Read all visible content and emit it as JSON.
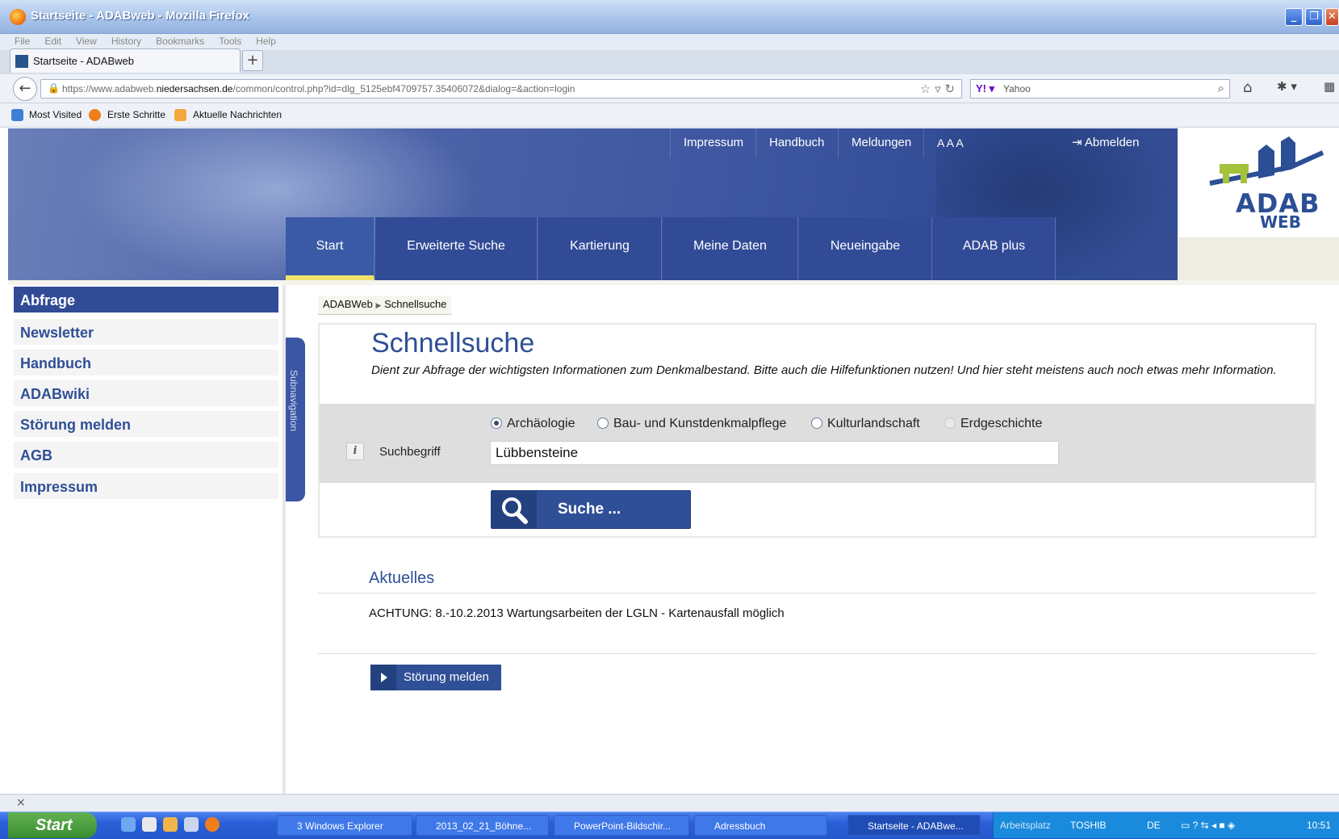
{
  "window": {
    "title": "Startseite - ADABweb - Mozilla Firefox",
    "min": "_",
    "max": "❐",
    "close": "✕"
  },
  "menubar": [
    "File",
    "Edit",
    "View",
    "History",
    "Bookmarks",
    "Tools",
    "Help"
  ],
  "tab": {
    "label": "Startseite - ADABweb",
    "new": "+"
  },
  "address": {
    "url_prefix": "https://www.adabweb.",
    "url_host": "niedersachsen.de",
    "url_rest": "/common/control.php?id=dlg_5125ebf4709757.35406072&dialog=&action=login"
  },
  "search": {
    "engine": "Yahoo"
  },
  "bookmarks": [
    "Most Visited",
    "Erste Schritte",
    "Aktuelle Nachrichten"
  ],
  "toplinks": [
    "Impressum",
    "Handbuch",
    "Meldungen"
  ],
  "fontsize": "A A A",
  "logout": "Abmelden",
  "logo": {
    "line1": "ADAB",
    "line2": "WEB"
  },
  "mainnav": [
    "Start",
    "Erweiterte Suche",
    "Kartierung",
    "Meine Daten",
    "Neueingabe",
    "ADAB plus"
  ],
  "sidebar": [
    "Abfrage",
    "Newsletter",
    "Handbuch",
    "ADABwiki",
    "Störung melden",
    "AGB",
    "Impressum"
  ],
  "subnav_label": "Subnavigation",
  "breadcrumb": {
    "root": "ADABWeb",
    "current": "Schnellsuche"
  },
  "page": {
    "title": "Schnellsuche",
    "description": "Dient zur Abfrage der wichtigsten Informationen zum Denkmalbestand. Bitte auch die Hilfefunktionen nutzen! Und hier steht meistens auch noch etwas mehr Information."
  },
  "form": {
    "radios": [
      "Archäologie",
      "Bau- und Kunstdenkmalpflege",
      "Kulturlandschaft",
      "Erdgeschichte"
    ],
    "selected": "Archäologie",
    "info": "i",
    "label": "Suchbegriff",
    "value": "Lübbensteine",
    "submit": "Suche ..."
  },
  "news": {
    "heading": "Aktuelles",
    "item": "ACHTUNG: 8.-10.2.2013 Wartungsarbeiten der LGLN - Kartenausfall möglich"
  },
  "report_button": "Störung melden",
  "statusbar": {
    "close": "×"
  },
  "taskbar": {
    "start": "Start",
    "items": [
      "3 Windows Explorer",
      "2013_02_21_Böhne...",
      "PowerPoint-Bildschir...",
      "Adressbuch",
      "Startseite - ADABwe..."
    ],
    "tray": {
      "workspace": "Arbeitsplatz",
      "drive": "TOSHIB",
      "lang": "DE",
      "time": "10:51"
    }
  },
  "colors": {
    "brand": "#2f4f96",
    "accent": "#f1e26b",
    "taskbar": "#2a5fd8"
  }
}
